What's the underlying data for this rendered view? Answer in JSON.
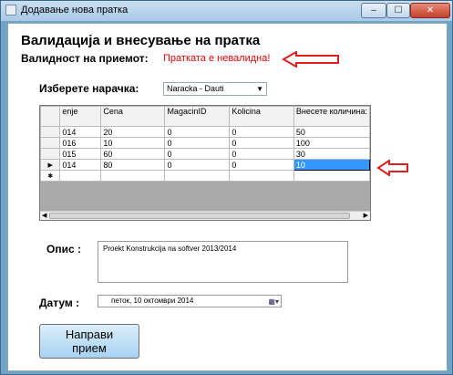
{
  "window": {
    "title": "Додавање нова пратка",
    "min": "–",
    "max": "☐",
    "close": "✕"
  },
  "heading": "Валидација и внесување на пратка",
  "validity": {
    "label": "Валидност на приемот:",
    "value": "Пратката е невалидна!"
  },
  "order": {
    "label": "Изберете нарачка:",
    "selected": "Naracka - Dauti"
  },
  "grid": {
    "columns": [
      "enje",
      "Cena",
      "MagacinID",
      "Kolicina",
      "Внесете количина:"
    ],
    "rows": [
      {
        "marker": "",
        "cells": [
          "014",
          "20",
          "0",
          "0",
          "50"
        ]
      },
      {
        "marker": "",
        "cells": [
          "016",
          "10",
          "0",
          "0",
          "100"
        ]
      },
      {
        "marker": "",
        "cells": [
          "015",
          "60",
          "0",
          "0",
          "30"
        ]
      },
      {
        "marker": "▶",
        "cells": [
          "014",
          "80",
          "0",
          "0",
          "10"
        ]
      }
    ],
    "new_row_marker": "✱"
  },
  "description": {
    "label": "Опис :",
    "value": "Proekt Konstrukcija na softver 2013/2014"
  },
  "date": {
    "label": "Датум :",
    "day": "петок",
    "value": ", 10  октомври  2014"
  },
  "submit": {
    "line1": "Направи",
    "line2": "прием"
  },
  "colors": {
    "error": "#ee0000",
    "arrow": "#e02020",
    "selection": "#3399ff"
  }
}
